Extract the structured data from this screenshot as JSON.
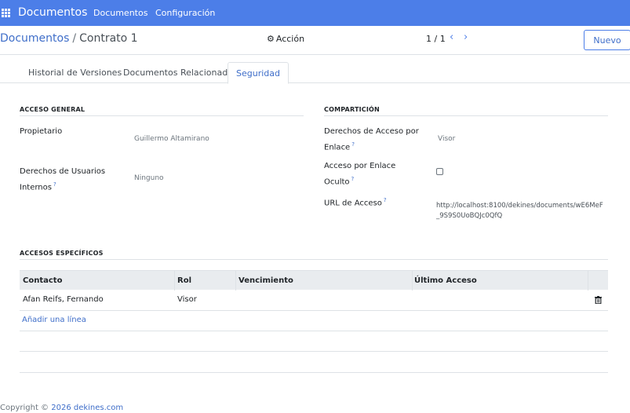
{
  "navbar": {
    "brand": "Documentos",
    "menu": [
      "Documentos",
      "Configuración"
    ]
  },
  "control": {
    "breadcrumb_parent": "Documentos",
    "breadcrumb_sep": "/",
    "breadcrumb_current": "Contrato 1",
    "accion_label": "Acción",
    "pager_text": "1 / 1",
    "new_label": "Nuevo"
  },
  "tabs": [
    {
      "label": "Historial de Versiones",
      "active": false
    },
    {
      "label": "Documentos Relacionados",
      "active": false
    },
    {
      "label": "Seguridad",
      "active": true
    }
  ],
  "general": {
    "title": "ACCESO GENERAL",
    "owner_label": "Propietario",
    "owner_value": "Guillermo Altamirano",
    "internal_label_1": "Derechos de Usuarios",
    "internal_label_2": "Internos",
    "internal_value": "Ninguno"
  },
  "sharing": {
    "title": "COMPARTICIÓN",
    "link_rights_label_1": "Derechos de Acceso por",
    "link_rights_label_2": "Enlace",
    "link_rights_value": "Visor",
    "hidden_label_1": "Acceso por Enlace",
    "hidden_label_2": "Oculto",
    "url_label": "URL de Acceso",
    "url_value": "http://localhost:8100/dekines/documents/wE6MeF_9S9S0UoBQJc0QfQ"
  },
  "specific": {
    "title": "ACCESOS ESPECÍFICOS",
    "columns": [
      "Contacto",
      "Rol",
      "Vencimiento",
      "Último Acceso"
    ],
    "rows": [
      {
        "contact": "Afan Reifs, Fernando",
        "role": "Visor",
        "expiry": "",
        "last_access": ""
      }
    ],
    "add_line": "Añadir una línea"
  },
  "footer": {
    "copyright": "Copyright ©",
    "link": "2026 dekines.com"
  },
  "help_mark": "?"
}
